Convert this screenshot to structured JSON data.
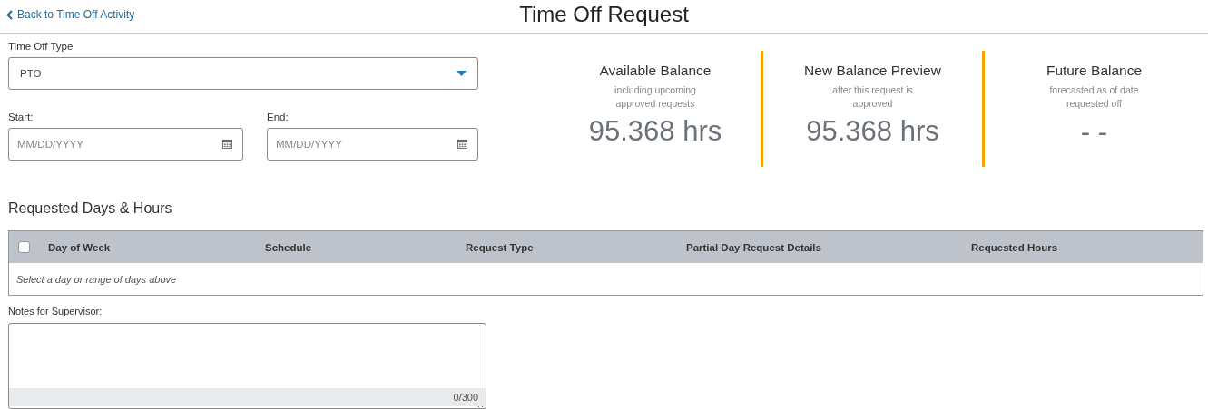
{
  "header": {
    "back_link": "Back to Time Off Activity",
    "title": "Time Off Request"
  },
  "form": {
    "type_label": "Time Off Type",
    "type_value": "PTO",
    "start_label": "Start:",
    "start_placeholder": "MM/DD/YYYY",
    "end_label": "End:",
    "end_placeholder": "MM/DD/YYYY"
  },
  "balances": [
    {
      "title": "Available Balance",
      "subtitle": "including upcoming approved requests",
      "value": "95.368 hrs"
    },
    {
      "title": "New Balance Preview",
      "subtitle": "after this request is approved",
      "value": "95.368 hrs"
    },
    {
      "title": "Future Balance",
      "subtitle": "forecasted as of date requested off",
      "value": "- -"
    }
  ],
  "days_section": {
    "title": "Requested Days & Hours",
    "select_all_checked": false,
    "columns": [
      "Day of Week",
      "Schedule",
      "Request Type",
      "Partial Day Request Details",
      "Requested Hours"
    ],
    "empty_message": "Select a day or range of days above"
  },
  "notes": {
    "label": "Notes for Supervisor:",
    "counter": "0/300"
  }
}
